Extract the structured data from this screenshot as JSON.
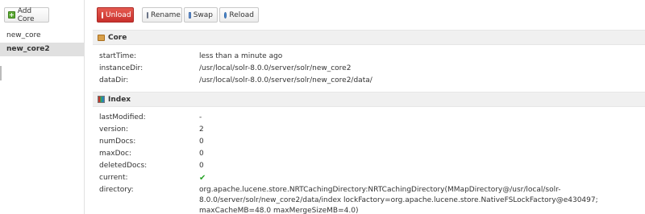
{
  "sidebar": {
    "add_core_label": "Add Core",
    "cores": [
      {
        "label": "new_core",
        "selected": false
      },
      {
        "label": "new_core2",
        "selected": true
      }
    ]
  },
  "toolbar": {
    "unload_label": "Unload",
    "rename_label": "Rename",
    "swap_label": "Swap",
    "reload_label": "Reload"
  },
  "core_section": {
    "title": "Core",
    "properties": [
      {
        "label": "startTime:",
        "value": "less than a minute ago"
      },
      {
        "label": "instanceDir:",
        "value": "/usr/local/solr-8.0.0/server/solr/new_core2"
      },
      {
        "label": "dataDir:",
        "value": "/usr/local/solr-8.0.0/server/solr/new_core2/data/"
      }
    ]
  },
  "index_section": {
    "title": "Index",
    "properties": [
      {
        "label": "lastModified:",
        "value": "-"
      },
      {
        "label": "version:",
        "value": "2"
      },
      {
        "label": "numDocs:",
        "value": "0"
      },
      {
        "label": "maxDoc:",
        "value": "0"
      },
      {
        "label": "deletedDocs:",
        "value": "0"
      },
      {
        "label": "current:",
        "value": "✔"
      },
      {
        "label": "directory:",
        "value": "org.apache.lucene.store.NRTCachingDirectory:NRTCachingDirectory(MMapDirectory@/usr/local/solr-8.0.0/server/solr/new_core2/data/index lockFactory=org.apache.lucene.store.NativeFSLockFactory@e430497; maxCacheMB=48.0 maxMergeSizeMB=4.0)"
      }
    ]
  },
  "colors": {
    "unload_bg": "#d9534f",
    "check": "#27a327",
    "section_bg": "#f0f0f0"
  }
}
